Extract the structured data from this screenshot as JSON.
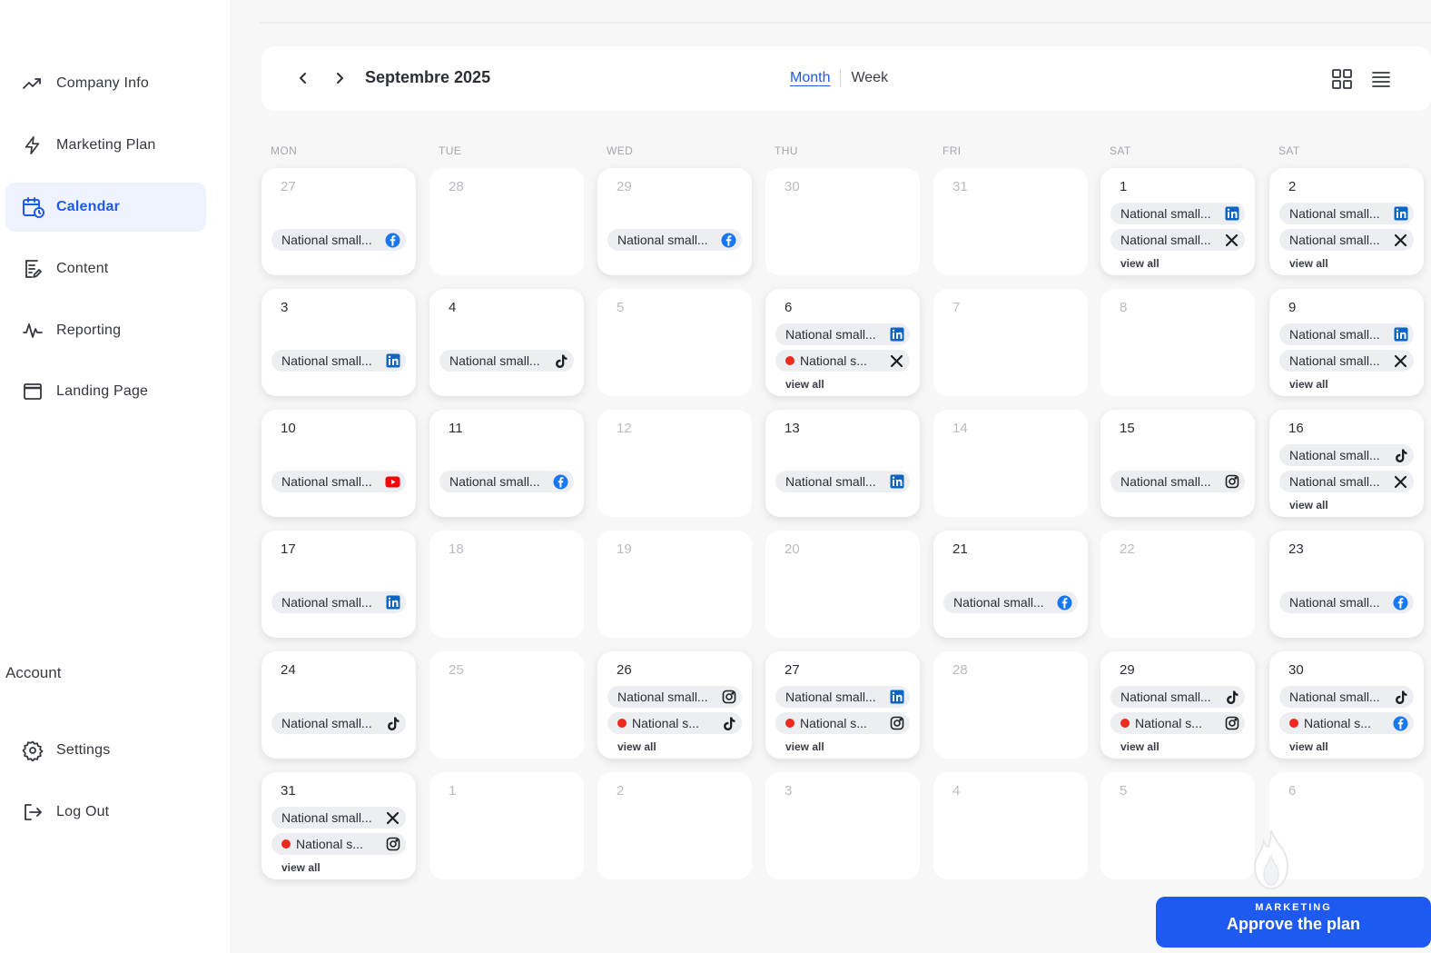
{
  "sidebar": {
    "items": [
      {
        "label": "Company Info",
        "icon": "trend-up-icon"
      },
      {
        "label": "Marketing Plan",
        "icon": "lightning-icon"
      },
      {
        "label": "Calendar",
        "icon": "calendar-icon",
        "active": true
      },
      {
        "label": "Content",
        "icon": "document-edit-icon"
      },
      {
        "label": "Reporting",
        "icon": "pulse-icon"
      },
      {
        "label": "Landing Page",
        "icon": "window-icon"
      }
    ],
    "account_label": "Account",
    "account_items": [
      {
        "label": "Settings",
        "icon": "gear-icon"
      },
      {
        "label": "Log Out",
        "icon": "logout-icon"
      }
    ]
  },
  "header": {
    "month_title": "Septembre 2025",
    "view_tabs": [
      {
        "label": "Month",
        "active": true
      },
      {
        "label": "Week"
      }
    ]
  },
  "day_headers": [
    "MON",
    "TUE",
    "WED",
    "THU",
    "FRI",
    "SAT",
    "SAT"
  ],
  "colors": {
    "accent": "#1f5af0",
    "facebook": "#1877f2",
    "linkedin": "#0a66c2",
    "youtube": "#ff0000",
    "status_dot": "#ee2a1f"
  },
  "calendar": {
    "weeks": [
      [
        {
          "day": "27",
          "muted": true,
          "posts": [
            {
              "text": "National small...",
              "platform": "facebook"
            }
          ]
        },
        {
          "day": "28",
          "muted": true,
          "posts": []
        },
        {
          "day": "29",
          "muted": true,
          "posts": [
            {
              "text": "National small...",
              "platform": "facebook"
            }
          ]
        },
        {
          "day": "30",
          "muted": true,
          "posts": []
        },
        {
          "day": "31",
          "muted": true,
          "posts": []
        },
        {
          "day": "1",
          "posts": [
            {
              "text": "National small...",
              "platform": "linkedin"
            },
            {
              "text": "National small...",
              "platform": "x"
            }
          ],
          "view_all": "view all"
        },
        {
          "day": "2",
          "posts": [
            {
              "text": "National small...",
              "platform": "linkedin"
            },
            {
              "text": "National small...",
              "platform": "x"
            }
          ],
          "view_all": "view all"
        }
      ],
      [
        {
          "day": "3",
          "posts": [
            {
              "text": "National small...",
              "platform": "linkedin"
            }
          ]
        },
        {
          "day": "4",
          "posts": [
            {
              "text": "National small...",
              "platform": "tiktok"
            }
          ]
        },
        {
          "day": "5",
          "muted": true,
          "posts": []
        },
        {
          "day": "6",
          "posts": [
            {
              "text": "National small...",
              "platform": "linkedin"
            },
            {
              "text": "National s...",
              "platform": "x",
              "dot": true
            }
          ],
          "view_all": "view all"
        },
        {
          "day": "7",
          "muted": true,
          "posts": []
        },
        {
          "day": "8",
          "muted": true,
          "posts": []
        },
        {
          "day": "9",
          "posts": [
            {
              "text": "National small...",
              "platform": "linkedin"
            },
            {
              "text": "National small...",
              "platform": "x"
            }
          ],
          "view_all": "view all"
        }
      ],
      [
        {
          "day": "10",
          "posts": [
            {
              "text": "National small...",
              "platform": "youtube"
            }
          ]
        },
        {
          "day": "11",
          "posts": [
            {
              "text": "National small...",
              "platform": "facebook"
            }
          ]
        },
        {
          "day": "12",
          "muted": true,
          "posts": []
        },
        {
          "day": "13",
          "posts": [
            {
              "text": "National small...",
              "platform": "linkedin"
            }
          ]
        },
        {
          "day": "14",
          "muted": true,
          "posts": []
        },
        {
          "day": "15",
          "posts": [
            {
              "text": "National small...",
              "platform": "instagram"
            }
          ]
        },
        {
          "day": "16",
          "posts": [
            {
              "text": "National small...",
              "platform": "tiktok"
            },
            {
              "text": "National small...",
              "platform": "x"
            }
          ],
          "view_all": "view all"
        }
      ],
      [
        {
          "day": "17",
          "posts": [
            {
              "text": "National small...",
              "platform": "linkedin"
            }
          ]
        },
        {
          "day": "18",
          "muted": true,
          "posts": []
        },
        {
          "day": "19",
          "muted": true,
          "posts": []
        },
        {
          "day": "20",
          "muted": true,
          "posts": []
        },
        {
          "day": "21",
          "posts": [
            {
              "text": "National small...",
              "platform": "facebook"
            }
          ]
        },
        {
          "day": "22",
          "muted": true,
          "posts": []
        },
        {
          "day": "23",
          "posts": [
            {
              "text": "National small...",
              "platform": "facebook"
            }
          ]
        }
      ],
      [
        {
          "day": "24",
          "posts": [
            {
              "text": "National small...",
              "platform": "tiktok"
            }
          ]
        },
        {
          "day": "25",
          "muted": true,
          "posts": []
        },
        {
          "day": "26",
          "posts": [
            {
              "text": "National small...",
              "platform": "instagram"
            },
            {
              "text": "National s...",
              "platform": "tiktok",
              "dot": true
            }
          ],
          "view_all": "view all"
        },
        {
          "day": "27",
          "posts": [
            {
              "text": "National small...",
              "platform": "linkedin"
            },
            {
              "text": "National s...",
              "platform": "instagram",
              "dot": true
            }
          ],
          "view_all": "view all"
        },
        {
          "day": "28",
          "muted": true,
          "posts": []
        },
        {
          "day": "29",
          "posts": [
            {
              "text": "National small...",
              "platform": "tiktok"
            },
            {
              "text": "National s...",
              "platform": "instagram",
              "dot": true
            }
          ],
          "view_all": "view all"
        },
        {
          "day": "30",
          "posts": [
            {
              "text": "National small...",
              "platform": "tiktok"
            },
            {
              "text": "National s...",
              "platform": "facebook",
              "dot": true
            }
          ],
          "view_all": "view all"
        }
      ],
      [
        {
          "day": "31",
          "posts": [
            {
              "text": "National small...",
              "platform": "x"
            },
            {
              "text": "National s...",
              "platform": "instagram",
              "dot": true
            }
          ],
          "view_all": "view all"
        },
        {
          "day": "1",
          "muted": true,
          "posts": []
        },
        {
          "day": "2",
          "muted": true,
          "posts": []
        },
        {
          "day": "3",
          "muted": true,
          "posts": []
        },
        {
          "day": "4",
          "muted": true,
          "posts": []
        },
        {
          "day": "5",
          "muted": true,
          "posts": []
        },
        {
          "day": "6",
          "muted": true,
          "posts": []
        }
      ]
    ]
  },
  "approve": {
    "label": "Approve the plan",
    "watermark": "MARKETING"
  }
}
